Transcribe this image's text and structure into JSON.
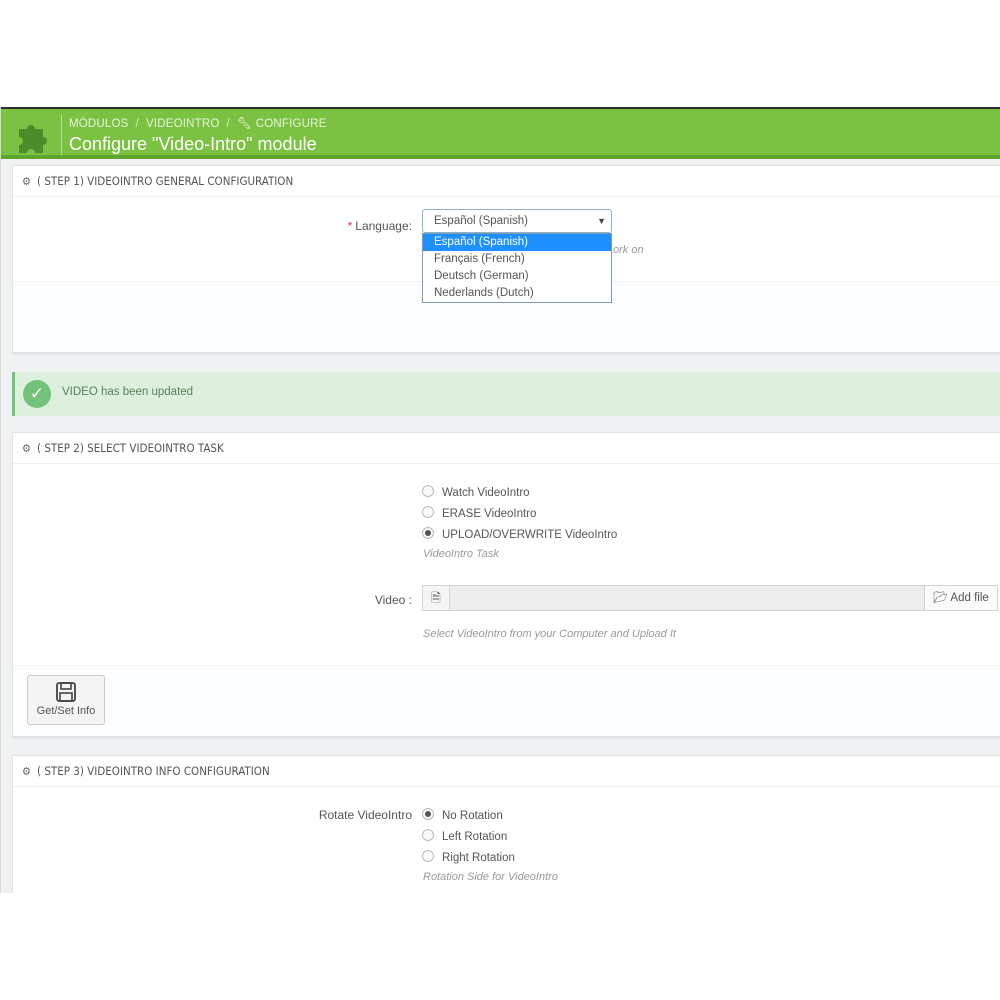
{
  "header": {
    "breadcrumbs": [
      "MÓDULOS",
      "VIDEOINTRO",
      "CONFIGURE"
    ],
    "title": "Configure \"Video-Intro\" module",
    "logo_icon": "puzzle-piece-icon",
    "accent": "#7cc242"
  },
  "step1": {
    "title": "( STEP 1) VIDEOINTRO GENERAL CONFIGURATION",
    "language_label": "Language:",
    "required_mark": "*",
    "selected": "Español (Spanish)",
    "options": [
      "Español (Spanish)",
      "Français (French)",
      "Deutsch (German)",
      "Nederlands (Dutch)"
    ],
    "help_partial": "ork on"
  },
  "alert": {
    "message": "VIDEO has been updated",
    "color": "#72c279"
  },
  "step2": {
    "title": "( STEP 2) SELECT VIDEOINTRO TASK",
    "tasks": [
      "Watch VideoIntro",
      "ERASE VideoIntro",
      "UPLOAD/OVERWRITE VideoIntro"
    ],
    "selected_task": 2,
    "task_help": "VideoIntro Task",
    "video_label": "Video :",
    "add_file_label": "Add file",
    "video_help": "Select VideoIntro from your Computer and Upload It",
    "save_label": "Get/Set Info"
  },
  "step3": {
    "title": "( STEP 3) VIDEOINTRO INFO CONFIGURATION",
    "rotate_label": "Rotate VideoIntro",
    "rotations": [
      "No Rotation",
      "Left Rotation",
      "Right Rotation"
    ],
    "selected_rotation": 0,
    "rotate_help": "Rotation Side for VideoIntro"
  }
}
